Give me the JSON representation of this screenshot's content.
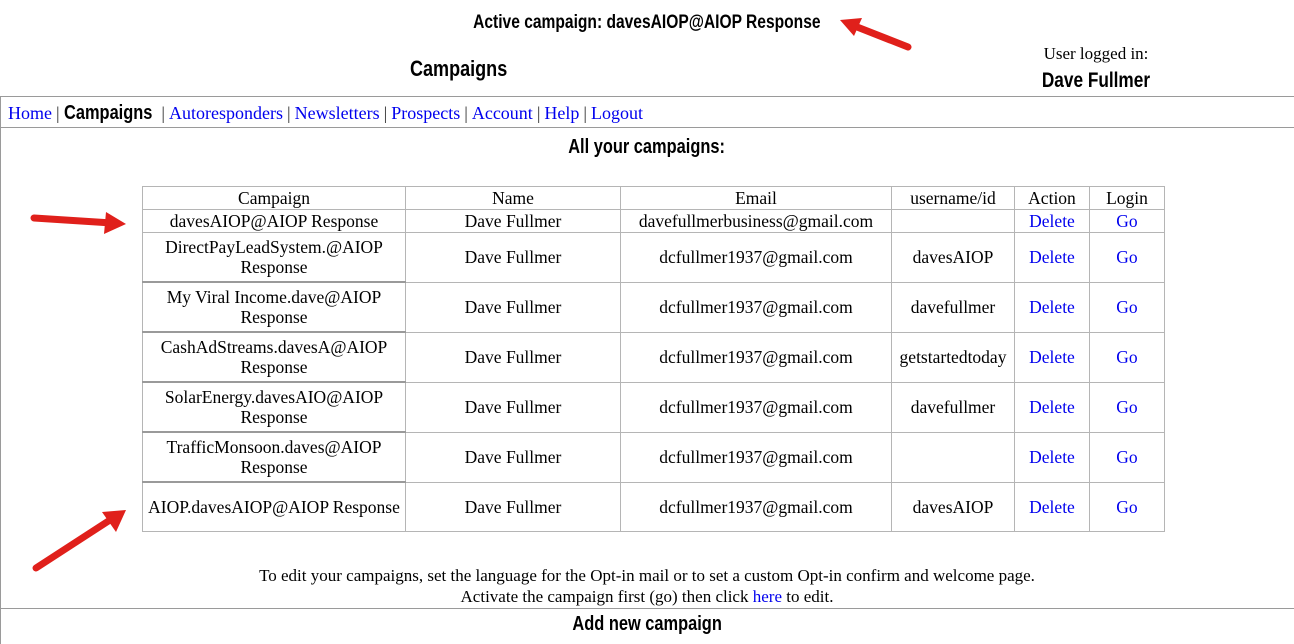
{
  "header": {
    "active_campaign_label": "Active campaign: davesAIOP@AIOP Response",
    "page_title": "Campaigns",
    "user_label": "User logged in:",
    "user_name": "Dave Fullmer"
  },
  "nav": {
    "items": [
      "Home",
      "Campaigns",
      "Autoresponders",
      "Newsletters",
      "Prospects",
      "Account",
      "Help",
      "Logout"
    ],
    "current": "Campaigns"
  },
  "section_title": "All your campaigns:",
  "table": {
    "headers": [
      "Campaign",
      "Name",
      "Email",
      "username/id",
      "Action",
      "Login"
    ],
    "rows": [
      {
        "campaign": "davesAIOP@AIOP Response",
        "name": "Dave Fullmer",
        "email": "davefullmerbusiness@gmail.com",
        "username": "",
        "action": "Delete",
        "login": "Go"
      },
      {
        "campaign": "DirectPayLeadSystem.@AIOP Response",
        "name": "Dave Fullmer",
        "email": "dcfullmer1937@gmail.com",
        "username": "davesAIOP",
        "action": "Delete",
        "login": "Go"
      },
      {
        "campaign": "My Viral Income.dave@AIOP Response",
        "name": "Dave Fullmer",
        "email": "dcfullmer1937@gmail.com",
        "username": "davefullmer",
        "action": "Delete",
        "login": "Go"
      },
      {
        "campaign": "CashAdStreams.davesA@AIOP Response",
        "name": "Dave Fullmer",
        "email": "dcfullmer1937@gmail.com",
        "username": "getstartedtoday",
        "action": "Delete",
        "login": "Go"
      },
      {
        "campaign": "SolarEnergy.davesAIO@AIOP Response",
        "name": "Dave Fullmer",
        "email": "dcfullmer1937@gmail.com",
        "username": "davefullmer",
        "action": "Delete",
        "login": "Go"
      },
      {
        "campaign": "TrafficMonsoon.daves@AIOP Response",
        "name": "Dave Fullmer",
        "email": "dcfullmer1937@gmail.com",
        "username": "",
        "action": "Delete",
        "login": "Go"
      },
      {
        "campaign": "AIOP.davesAIOP@AIOP Response",
        "name": "Dave Fullmer",
        "email": "dcfullmer1937@gmail.com",
        "username": "davesAIOP",
        "action": "Delete",
        "login": "Go"
      }
    ]
  },
  "footer": {
    "line1": "To edit your campaigns, set the language for the Opt-in mail or to set a custom Opt-in confirm and welcome page.",
    "line2_before": "Activate the campaign first (go) then click ",
    "line2_link": "here",
    "line2_after": " to edit."
  },
  "add_title": "Add new campaign",
  "colors": {
    "link": "#0000ee",
    "arrow": "#e0201b",
    "border": "#b5b5b5"
  }
}
